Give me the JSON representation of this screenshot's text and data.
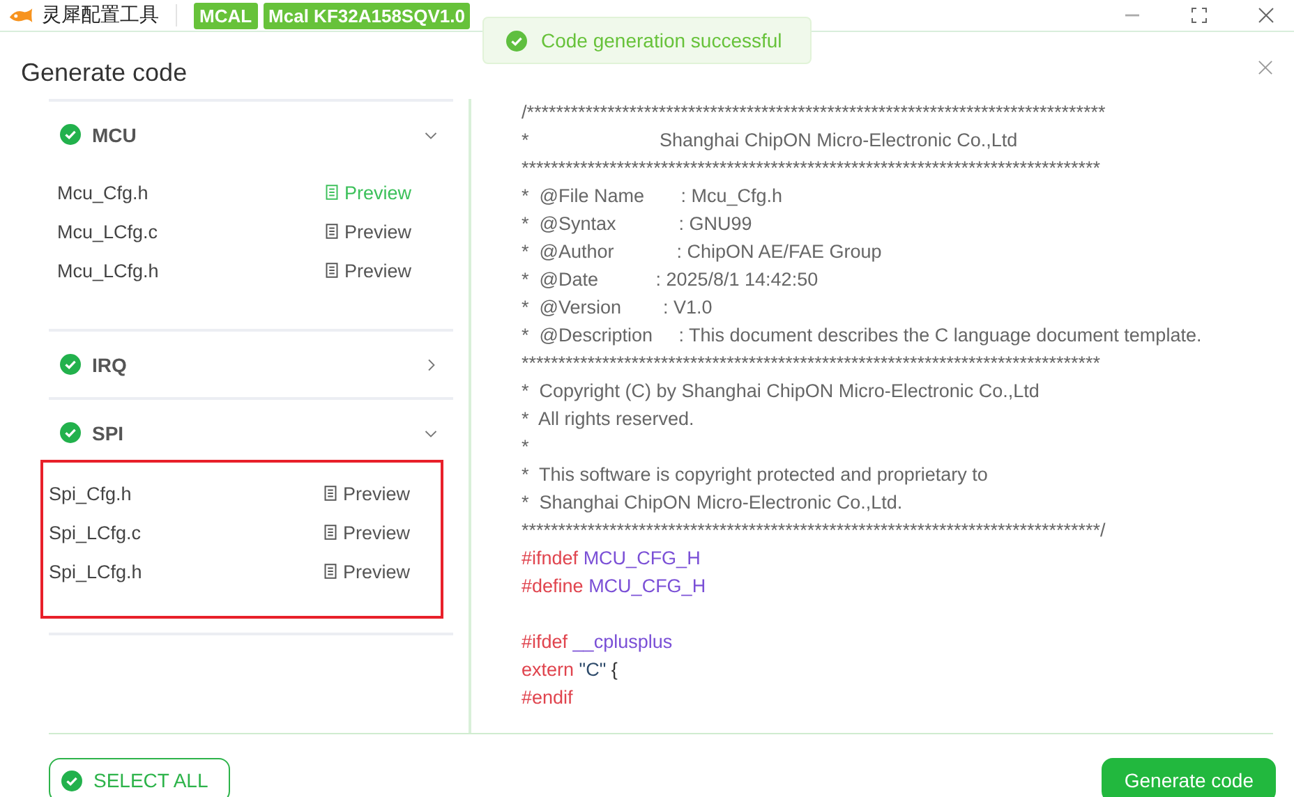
{
  "app": {
    "title": "灵犀配置工具",
    "tags": [
      "MCAL",
      "Mcal KF32A158SQV1.0"
    ]
  },
  "toast": {
    "message": "Code generation successful"
  },
  "dialog": {
    "title": "Generate code"
  },
  "modules": [
    {
      "name": "MCU",
      "done": true,
      "expanded": true,
      "files": [
        {
          "name": "Mcu_Cfg.h",
          "action": "Preview",
          "selected": true
        },
        {
          "name": "Mcu_LCfg.c",
          "action": "Preview",
          "selected": false
        },
        {
          "name": "Mcu_LCfg.h",
          "action": "Preview",
          "selected": false
        }
      ]
    },
    {
      "name": "IRQ",
      "done": true,
      "expanded": false
    },
    {
      "name": "SPI",
      "done": true,
      "expanded": true,
      "highlighted": true,
      "files": [
        {
          "name": "Spi_Cfg.h",
          "action": "Preview",
          "selected": false
        },
        {
          "name": "Spi_LCfg.c",
          "action": "Preview",
          "selected": false
        },
        {
          "name": "Spi_LCfg.h",
          "action": "Preview",
          "selected": false
        }
      ]
    }
  ],
  "code": [
    {
      "tokens": [
        {
          "kind": "comment",
          "text": "/*******************************************************************************"
        }
      ]
    },
    {
      "tokens": [
        {
          "kind": "comment",
          "text": "*                         Shanghai ChipON Micro-Electronic Co.,Ltd"
        }
      ]
    },
    {
      "tokens": [
        {
          "kind": "comment",
          "text": "*******************************************************************************"
        }
      ]
    },
    {
      "tokens": [
        {
          "kind": "comment",
          "text": "*  @File Name       : Mcu_Cfg.h"
        }
      ]
    },
    {
      "tokens": [
        {
          "kind": "comment",
          "text": "*  @Syntax            : GNU99"
        }
      ]
    },
    {
      "tokens": [
        {
          "kind": "comment",
          "text": "*  @Author            : ChipON AE/FAE Group"
        }
      ]
    },
    {
      "tokens": [
        {
          "kind": "comment",
          "text": "*  @Date           : 2025/8/1 14:42:50"
        }
      ]
    },
    {
      "tokens": [
        {
          "kind": "comment",
          "text": "*  @Version        : V1.0"
        }
      ]
    },
    {
      "tokens": [
        {
          "kind": "comment",
          "text": "*  @Description     : This document describes the C language document template."
        }
      ]
    },
    {
      "tokens": [
        {
          "kind": "comment",
          "text": "*******************************************************************************"
        }
      ]
    },
    {
      "tokens": [
        {
          "kind": "comment",
          "text": "*  Copyright (C) by Shanghai ChipON Micro-Electronic Co.,Ltd"
        }
      ]
    },
    {
      "tokens": [
        {
          "kind": "comment",
          "text": "*  All rights reserved."
        }
      ]
    },
    {
      "tokens": [
        {
          "kind": "comment",
          "text": "*"
        }
      ]
    },
    {
      "tokens": [
        {
          "kind": "comment",
          "text": "*  This software is copyright protected and proprietary to"
        }
      ]
    },
    {
      "tokens": [
        {
          "kind": "comment",
          "text": "*  Shanghai ChipON Micro-Electronic Co.,Ltd."
        }
      ]
    },
    {
      "tokens": [
        {
          "kind": "comment",
          "text": "*******************************************************************************/"
        }
      ]
    },
    {
      "tokens": [
        {
          "kind": "keyword",
          "text": "#ifndef"
        },
        {
          "kind": "macro",
          "text": "MCU_CFG_H"
        }
      ]
    },
    {
      "tokens": [
        {
          "kind": "keyword",
          "text": "#define"
        },
        {
          "kind": "macro",
          "text": "MCU_CFG_H"
        }
      ]
    },
    {
      "spaced": true,
      "tokens": [
        {
          "kind": "keyword",
          "text": "#ifdef"
        },
        {
          "kind": "macro",
          "text": "__cplusplus"
        }
      ]
    },
    {
      "tokens": [
        {
          "kind": "keyword",
          "text": "extern"
        },
        {
          "kind": "string",
          "text": "\"C\""
        },
        {
          "kind": "plain",
          "text": "{"
        }
      ]
    },
    {
      "tokens": [
        {
          "kind": "keyword",
          "text": "#endif"
        }
      ]
    }
  ],
  "footer": {
    "select_all": "SELECT ALL",
    "generate": "Generate code"
  }
}
